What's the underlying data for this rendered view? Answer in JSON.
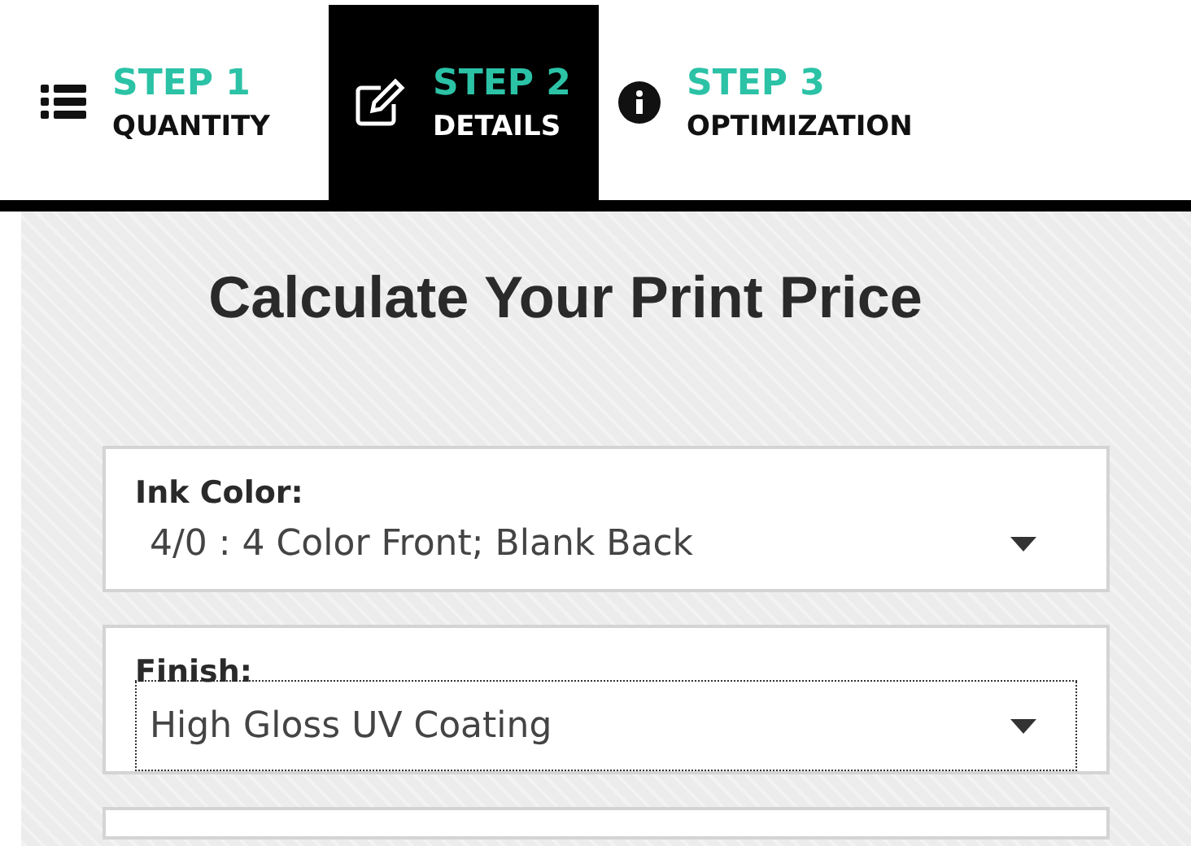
{
  "steps": [
    {
      "kind": "list",
      "step": "STEP 1",
      "label": "QUANTITY",
      "selected": false
    },
    {
      "kind": "edit",
      "step": "STEP 2",
      "label": "DETAILS",
      "selected": true
    },
    {
      "kind": "info",
      "step": "STEP 3",
      "label": "OPTIMIZATION",
      "selected": false
    }
  ],
  "title": "Calculate Your Print Price",
  "fields": [
    {
      "label": "Ink Color:",
      "value": "4/0 : 4 Color Front; Blank Back",
      "focused": false
    },
    {
      "label": "Finish:",
      "value": "High Gloss UV Coating",
      "focused": true
    }
  ]
}
